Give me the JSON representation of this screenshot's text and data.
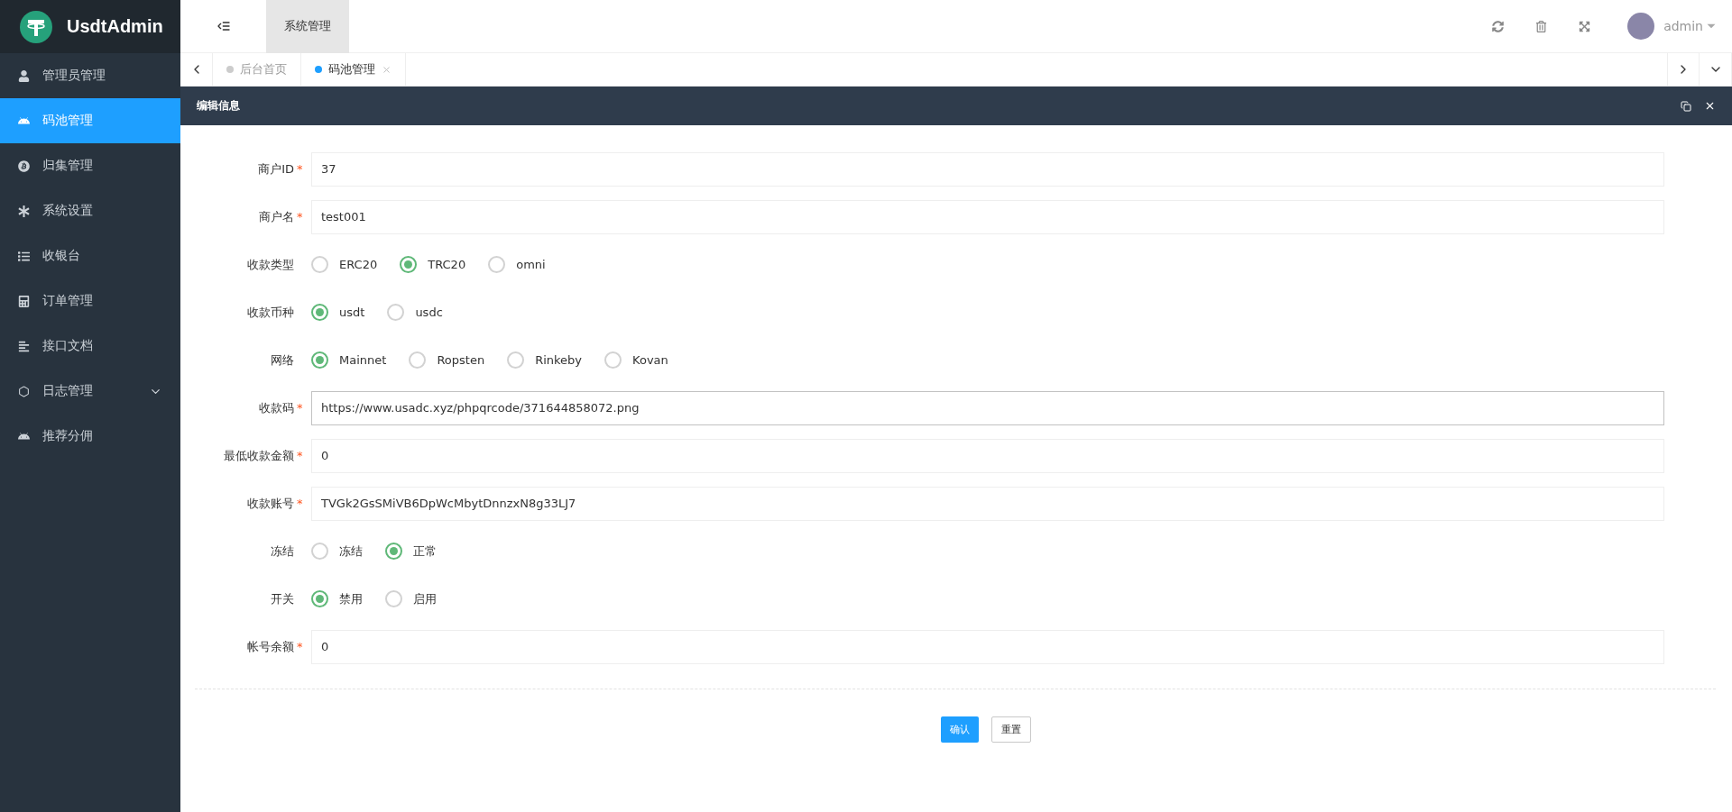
{
  "brand": {
    "title": "UsdtAdmin"
  },
  "header": {
    "menu_tab": "系统管理",
    "user": "admin"
  },
  "sidebar": {
    "items": [
      {
        "label": "管理员管理",
        "selected": false,
        "expandable": false
      },
      {
        "label": "码池管理",
        "selected": true,
        "expandable": false
      },
      {
        "label": "归集管理",
        "selected": false,
        "expandable": false
      },
      {
        "label": "系统设置",
        "selected": false,
        "expandable": false
      },
      {
        "label": "收银台",
        "selected": false,
        "expandable": false
      },
      {
        "label": "订单管理",
        "selected": false,
        "expandable": false
      },
      {
        "label": "接口文档",
        "selected": false,
        "expandable": false
      },
      {
        "label": "日志管理",
        "selected": false,
        "expandable": true
      },
      {
        "label": "推荐分佣",
        "selected": false,
        "expandable": false
      }
    ]
  },
  "tabs": [
    {
      "label": "后台首页",
      "selected": false,
      "closable": false
    },
    {
      "label": "码池管理",
      "selected": true,
      "closable": true
    }
  ],
  "panel": {
    "title": "编辑信息"
  },
  "form": {
    "rows": [
      {
        "kind": "input",
        "label": "商户ID",
        "required": true,
        "value": "37",
        "focused": false
      },
      {
        "kind": "input",
        "label": "商户名",
        "required": true,
        "value": "test001",
        "focused": false
      },
      {
        "kind": "radio",
        "label": "收款类型",
        "required": false,
        "options": [
          {
            "label": "ERC20",
            "selected": false
          },
          {
            "label": "TRC20",
            "selected": true
          },
          {
            "label": "omni",
            "selected": false
          }
        ]
      },
      {
        "kind": "radio",
        "label": "收款币种",
        "required": false,
        "options": [
          {
            "label": "usdt",
            "selected": true
          },
          {
            "label": "usdc",
            "selected": false
          }
        ]
      },
      {
        "kind": "radio",
        "label": "网络",
        "required": false,
        "options": [
          {
            "label": "Mainnet",
            "selected": true
          },
          {
            "label": "Ropsten",
            "selected": false
          },
          {
            "label": "Rinkeby",
            "selected": false
          },
          {
            "label": "Kovan",
            "selected": false
          }
        ]
      },
      {
        "kind": "input",
        "label": "收款码",
        "required": true,
        "value": "https://www.usadc.xyz/phpqrcode/371644858072.png",
        "focused": true
      },
      {
        "kind": "input",
        "label": "最低收款金额",
        "required": true,
        "value": "0",
        "focused": false
      },
      {
        "kind": "input",
        "label": "收款账号",
        "required": true,
        "value": "TVGk2GsSMiVB6DpWcMbytDnnzxN8g33LJ7",
        "focused": false
      },
      {
        "kind": "radio",
        "label": "冻结",
        "required": false,
        "options": [
          {
            "label": "冻结",
            "selected": false
          },
          {
            "label": "正常",
            "selected": true
          }
        ]
      },
      {
        "kind": "radio",
        "label": "开关",
        "required": false,
        "options": [
          {
            "label": "禁用",
            "selected": true
          },
          {
            "label": "启用",
            "selected": false
          }
        ]
      },
      {
        "kind": "input",
        "label": "帐号余额",
        "required": true,
        "value": "0",
        "focused": false
      }
    ],
    "required_mark": "*",
    "buttons": [
      {
        "label": "确认",
        "kind": "primary"
      },
      {
        "label": "重置",
        "kind": "default"
      }
    ]
  }
}
